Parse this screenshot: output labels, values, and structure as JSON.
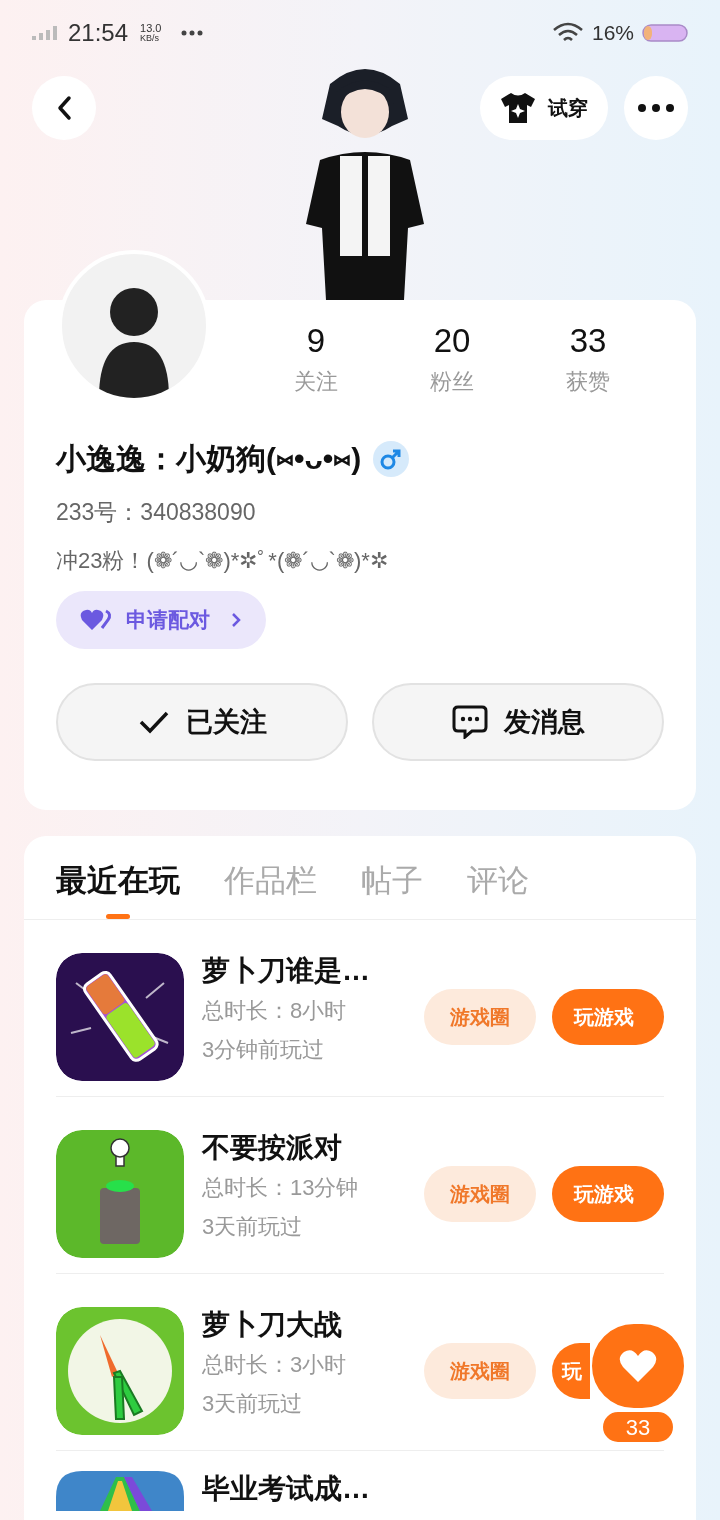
{
  "status_bar": {
    "time": "21:54",
    "speed_value": "13.0",
    "speed_unit": "KB/s",
    "battery": "16%"
  },
  "header": {
    "try_on_button": "试穿"
  },
  "profile": {
    "stats": [
      {
        "value": "9",
        "label": "关注"
      },
      {
        "value": "20",
        "label": "粉丝"
      },
      {
        "value": "33",
        "label": "获赞"
      }
    ],
    "name": "小逸逸：小奶狗(⑅•ᴗ•⑅)",
    "id_text": "233号：340838090",
    "bio": "冲23粉！(❁´◡`❁)*✲ﾟ*(❁´◡`❁)*✲",
    "pair_button": "申请配对",
    "follow_button": {
      "label": "已关注",
      "followed": true
    },
    "message_button": "发消息"
  },
  "tabs": [
    {
      "label": "最近在玩",
      "selected": true
    },
    {
      "label": "作品栏",
      "selected": false
    },
    {
      "label": "帖子",
      "selected": false
    },
    {
      "label": "评论",
      "selected": false
    }
  ],
  "games": [
    {
      "title": "萝卜刀谁是…",
      "duration": "总时长：8小时",
      "last_played": "3分钟前玩过",
      "circle_button": "游戏圈",
      "play_button": "玩游戏",
      "play_button_partial": false,
      "kind": "knife"
    },
    {
      "title": "不要按派对",
      "duration": "总时长：13分钟",
      "last_played": "3天前玩过",
      "circle_button": "游戏圈",
      "play_button": "玩游戏",
      "play_button_partial": false,
      "kind": "button"
    },
    {
      "title": "萝卜刀大战",
      "duration": "总时长：3小时",
      "last_played": "3天前玩过",
      "circle_button": "游戏圈",
      "play_button": "玩",
      "play_button_partial": true,
      "kind": "carrot"
    },
    {
      "title": "毕业考试成…",
      "kind": "rainbow"
    }
  ],
  "like_fab": {
    "count": "33"
  }
}
